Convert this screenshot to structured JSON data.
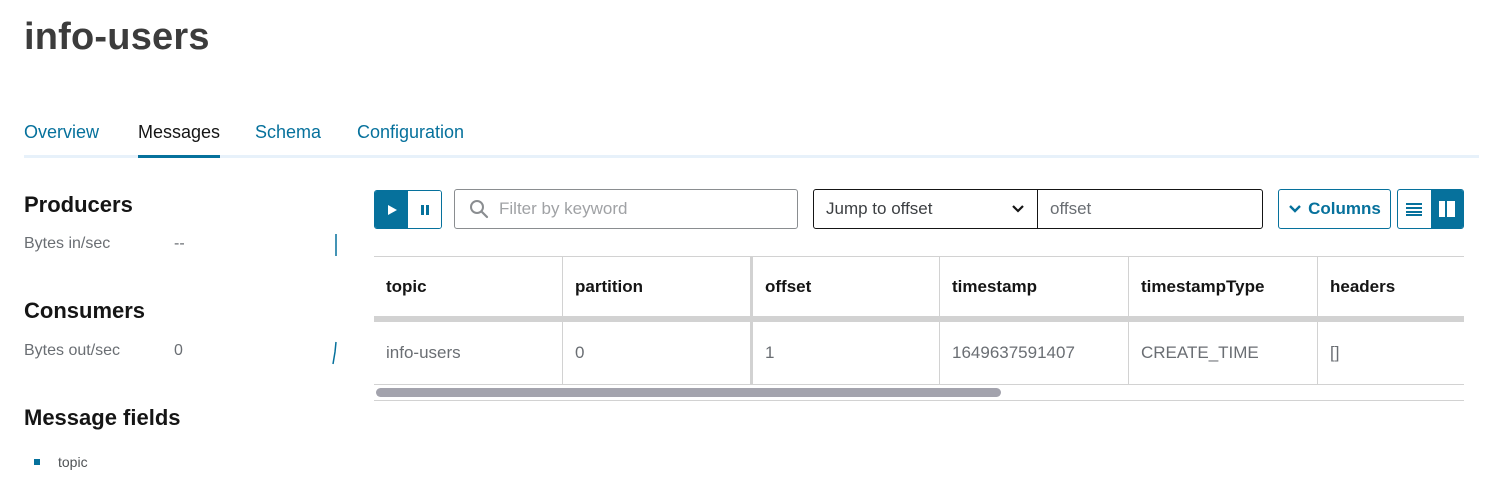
{
  "page": {
    "title": "info-users"
  },
  "tabs": [
    {
      "label": "Overview"
    },
    {
      "label": "Messages"
    },
    {
      "label": "Schema"
    },
    {
      "label": "Configuration"
    }
  ],
  "active_tab": "Messages",
  "sidebar": {
    "producers": {
      "heading": "Producers",
      "metric_label": "Bytes in/sec",
      "metric_value": "--"
    },
    "consumers": {
      "heading": "Consumers",
      "metric_label": "Bytes out/sec",
      "metric_value": "0"
    },
    "message_fields": {
      "heading": "Message fields",
      "items": [
        "topic"
      ]
    }
  },
  "toolbar": {
    "play_icon": "play-icon",
    "pause_icon": "pause-icon",
    "search_placeholder": "Filter by keyword",
    "jump_select_value": "Jump to offset",
    "offset_placeholder": "offset",
    "columns_label": "Columns",
    "view_icons": [
      "list-view-icon",
      "card-view-icon"
    ]
  },
  "table": {
    "columns": [
      "topic",
      "partition",
      "offset",
      "timestamp",
      "timestampType",
      "headers"
    ],
    "rows": [
      [
        "info-users",
        "0",
        "1",
        "1649637591407",
        "CREATE_TIME",
        "[]"
      ]
    ]
  },
  "colors": {
    "accent": "#06719c",
    "text": "#151515",
    "muted": "#6a6e73",
    "border": "#d2d2d2"
  }
}
